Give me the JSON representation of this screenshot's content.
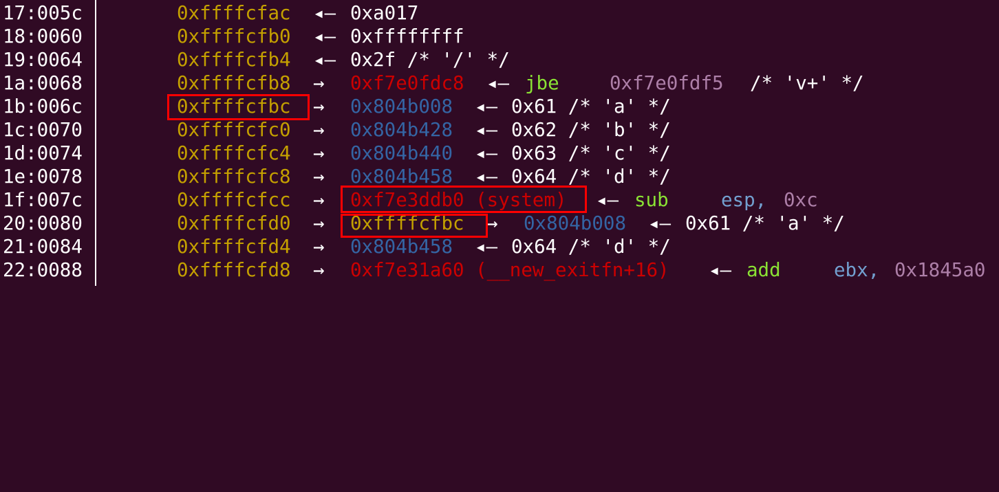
{
  "colors": {
    "background": "#300a24",
    "stack": "#c4a000",
    "heap": "#3465a4",
    "code": "#cc0000",
    "data": "#ad7fa8",
    "instruction": "#8ae234",
    "register": "#729fcf",
    "highlight": "#ff0000"
  },
  "arrows": {
    "points_to": "→",
    "dereferences_to": "◂—"
  },
  "rows": [
    {
      "index": "17:005c",
      "address": "0xffffcfac",
      "arrow1": "◂—",
      "value": "0xa017"
    },
    {
      "index": "18:0060",
      "address": "0xffffcfb0",
      "arrow1": "◂—",
      "value": "0xffffffff"
    },
    {
      "index": "19:0064",
      "address": "0xffffcfb4",
      "arrow1": "◂—",
      "value": "0x2f /* '/' */"
    },
    {
      "index": "1a:0068",
      "address": "0xffffcfb8",
      "arrow1": "→",
      "ptr": "0xf7e0fdc8",
      "arrow2": "◂—",
      "instr": "jbe",
      "operand": "0xf7e0fdf5",
      "comment": "/* 'v+' */"
    },
    {
      "index": "1b:006c",
      "address": "0xffffcfbc",
      "arrow1": "→",
      "ptr": "0x804b008",
      "arrow2": "◂—",
      "value": "0x61 /* 'a' */"
    },
    {
      "index": "1c:0070",
      "address": "0xffffcfc0",
      "arrow1": "→",
      "ptr": "0x804b428",
      "arrow2": "◂—",
      "value": "0x62 /* 'b' */"
    },
    {
      "index": "1d:0074",
      "address": "0xffffcfc4",
      "arrow1": "→",
      "ptr": "0x804b440",
      "arrow2": "◂—",
      "value": "0x63 /* 'c' */"
    },
    {
      "index": "1e:0078",
      "address": "0xffffcfc8",
      "arrow1": "→",
      "ptr": "0x804b458",
      "arrow2": "◂—",
      "value": "0x64 /* 'd' */"
    },
    {
      "index": "1f:007c",
      "address": "0xffffcfcc",
      "arrow1": "→",
      "ptr": "0xf7e3ddb0 (system)",
      "arrow2": "◂—",
      "instr": "sub",
      "operand_reg": "esp,",
      "operand": "0xc"
    },
    {
      "index": "20:0080",
      "address": "0xffffcfd0",
      "arrow1": "→",
      "ptr": "0xffffcfbc",
      "arrow2": "→",
      "ptr2": "0x804b008",
      "arrow3": "◂—",
      "value": "0x61 /* 'a' */"
    },
    {
      "index": "21:0084",
      "address": "0xffffcfd4",
      "arrow1": "→",
      "ptr": "0x804b458",
      "arrow2": "◂—",
      "value": "0x64 /* 'd' */"
    },
    {
      "index": "22:0088",
      "address": "0xffffcfd8",
      "arrow1": "→",
      "ptr": "0xf7e31a60 (__new_exitfn+16)",
      "arrow2": "◂—",
      "instr": "add",
      "operand_reg": "ebx,",
      "operand": "0x1845a0"
    }
  ]
}
